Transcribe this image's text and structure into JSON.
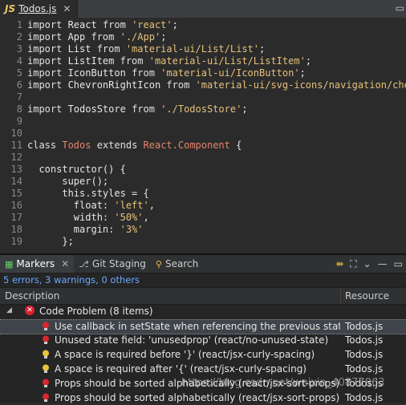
{
  "editor_tab": {
    "badge": "JS",
    "file": "Todos.js",
    "close": "✕",
    "win_controls": "▭"
  },
  "code_lines": [
    {
      "n": "1",
      "parts": [
        [
          "kw",
          "import "
        ],
        [
          "plain",
          "React "
        ],
        [
          "kw",
          "from "
        ],
        [
          "str",
          "'react'"
        ],
        [
          "plain",
          ";"
        ]
      ]
    },
    {
      "n": "2",
      "parts": [
        [
          "kw",
          "import "
        ],
        [
          "plain",
          "App "
        ],
        [
          "kw",
          "from "
        ],
        [
          "str",
          "'./App'"
        ],
        [
          "plain",
          ";"
        ]
      ]
    },
    {
      "n": "3",
      "parts": [
        [
          "kw",
          "import "
        ],
        [
          "plain",
          "List "
        ],
        [
          "kw",
          "from "
        ],
        [
          "str",
          "'material-ui/List/List'"
        ],
        [
          "plain",
          ";"
        ]
      ]
    },
    {
      "n": "4",
      "parts": [
        [
          "kw",
          "import "
        ],
        [
          "plain",
          "ListItem "
        ],
        [
          "kw",
          "from "
        ],
        [
          "str",
          "'material-ui/List/ListItem'"
        ],
        [
          "plain",
          ";"
        ]
      ]
    },
    {
      "n": "5",
      "parts": [
        [
          "kw",
          "import "
        ],
        [
          "plain",
          "IconButton "
        ],
        [
          "kw",
          "from "
        ],
        [
          "str",
          "'material-ui/IconButton'"
        ],
        [
          "plain",
          ";"
        ]
      ]
    },
    {
      "n": "6",
      "parts": [
        [
          "kw",
          "import "
        ],
        [
          "plain",
          "ChevronRightIcon "
        ],
        [
          "kw",
          "from "
        ],
        [
          "str",
          "'material-ui/svg-icons/navigation/chevr"
        ]
      ]
    },
    {
      "n": "7",
      "parts": []
    },
    {
      "n": "8",
      "parts": [
        [
          "kw",
          "import "
        ],
        [
          "plain",
          "TodosStore "
        ],
        [
          "kw",
          "from "
        ],
        [
          "str",
          "'./TodosStore'"
        ],
        [
          "plain",
          ";"
        ]
      ]
    },
    {
      "n": "9",
      "parts": []
    },
    {
      "n": "10",
      "parts": []
    },
    {
      "n": "11",
      "parts": [
        [
          "kw",
          "class "
        ],
        [
          "cls",
          "Todos "
        ],
        [
          "kw",
          "extends "
        ],
        [
          "cls",
          "React.Component "
        ],
        [
          "plain",
          "{"
        ]
      ]
    },
    {
      "n": "12",
      "parts": []
    },
    {
      "n": "13",
      "parts": [
        [
          "plain",
          "  constructor() {"
        ]
      ]
    },
    {
      "n": "14",
      "parts": [
        [
          "plain",
          "      super();"
        ]
      ]
    },
    {
      "n": "15",
      "parts": [
        [
          "plain",
          "      this.styles = {"
        ]
      ]
    },
    {
      "n": "16",
      "parts": [
        [
          "plain",
          "        float: "
        ],
        [
          "str",
          "'left'"
        ],
        [
          "plain",
          ","
        ]
      ]
    },
    {
      "n": "17",
      "parts": [
        [
          "plain",
          "        width: "
        ],
        [
          "str",
          "'50%'"
        ],
        [
          "plain",
          ","
        ]
      ]
    },
    {
      "n": "18",
      "parts": [
        [
          "plain",
          "        margin: "
        ],
        [
          "str",
          "'3%'"
        ]
      ]
    },
    {
      "n": "19",
      "parts": [
        [
          "plain",
          "      };"
        ]
      ]
    }
  ],
  "panel": {
    "tabs": [
      {
        "label": "Markers",
        "active": true,
        "close": "✕"
      },
      {
        "label": "Git Staging",
        "active": false
      },
      {
        "label": "Search",
        "active": false
      }
    ],
    "summary": "5 errors, 3 warnings, 0 others",
    "columns": {
      "description": "Description",
      "resource": "Resource"
    },
    "group": {
      "expander": "◢",
      "label": "Code Problem (8 items)"
    },
    "rows": [
      {
        "kind": "error",
        "text": "Use callback in setState when referencing the previous state. (react/no-access-state-in-setstate)",
        "resource": "Todos.js",
        "selected": true
      },
      {
        "kind": "error",
        "text": "Unused state field: 'unusedprop' (react/no-unused-state)",
        "resource": "Todos.js",
        "selected": false
      },
      {
        "kind": "warning",
        "text": "A space is required before '}' (react/jsx-curly-spacing)",
        "resource": "Todos.js",
        "selected": false
      },
      {
        "kind": "warning",
        "text": "A space is required after '{' (react/jsx-curly-spacing)",
        "resource": "Todos.js",
        "selected": false
      },
      {
        "kind": "error",
        "text": "Props should be sorted alphabetically (react/jsx-sort-props)",
        "resource": "Todos.js",
        "selected": false
      },
      {
        "kind": "error",
        "text": "Props should be sorted alphabetically (react/jsx-sort-props)",
        "resource": "Todos.js",
        "selected": false
      }
    ]
  },
  "watermark": "https://blog.csdn.net/weixin_40877863",
  "colors": {
    "error": "#d9262f",
    "warning": "#e8c23c",
    "summary": "#6aa9ff"
  }
}
